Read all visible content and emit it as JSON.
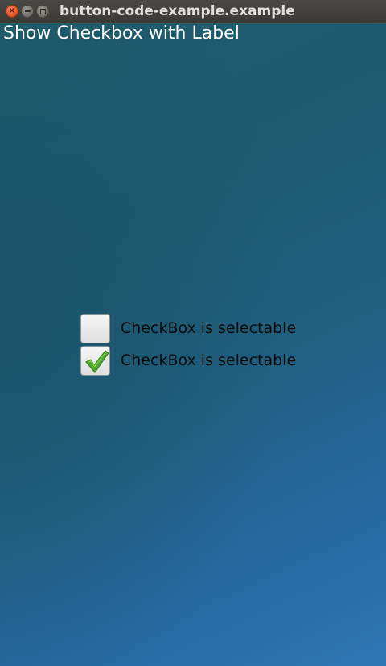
{
  "window": {
    "title": "button-code-example.example",
    "buttons": [
      "close-icon",
      "minimize-icon",
      "maximize-icon"
    ]
  },
  "page": {
    "heading": "Show Checkbox with Label"
  },
  "checkboxes": [
    {
      "label": "CheckBox is selectable",
      "checked": false
    },
    {
      "label": "CheckBox is selectable",
      "checked": true
    }
  ],
  "colors": {
    "titlebar": "#3f3e3a",
    "close_button": "#e1521e",
    "checkmark": "#4caa2a",
    "background_start": "#1f5c6a",
    "background_end": "#2c77b5"
  }
}
